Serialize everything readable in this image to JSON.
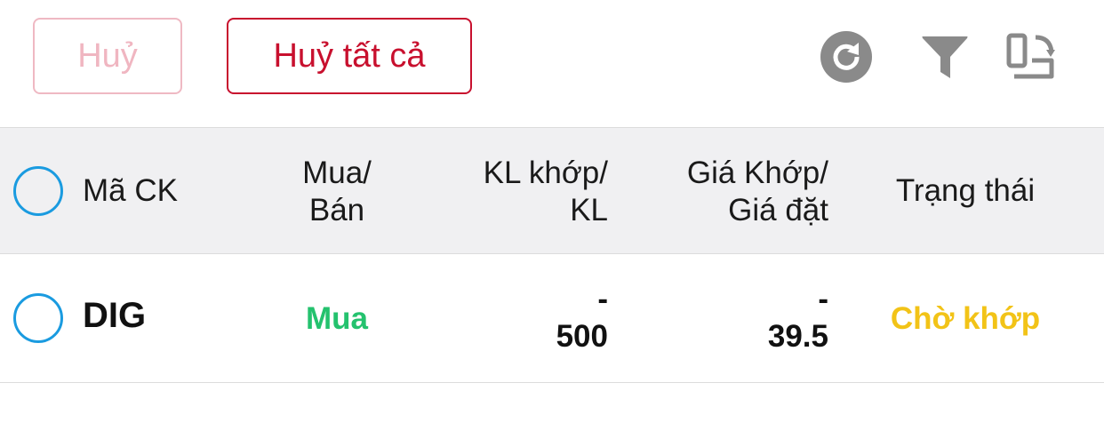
{
  "toolbar": {
    "cancel_label": "Huỷ",
    "cancel_all_label": "Huỷ tất cả",
    "icons": [
      "refresh-icon",
      "filter-icon",
      "layout-switch-icon"
    ]
  },
  "table": {
    "headers": {
      "code": "Mã CK",
      "side_line1": "Mua/",
      "side_line2": "Bán",
      "qty_line1": "KL khớp/",
      "qty_line2": "KL",
      "price_line1": "Giá Khớp/",
      "price_line2": "Giá đặt",
      "status": "Trạng thái"
    },
    "rows": [
      {
        "code": "DIG",
        "side": "Mua",
        "matched_qty": "-",
        "order_qty": "500",
        "matched_price": "-",
        "order_price": "39.5",
        "status": "Chờ khớp"
      }
    ]
  },
  "colors": {
    "primary_red": "#c8102e",
    "disabled_pink": "#f0b6c1",
    "buy_green": "#24c26e",
    "pending_yellow": "#f2c317",
    "radio_blue": "#1a9be0",
    "icon_gray": "#8a8a8a",
    "header_bg": "#f0f0f2"
  }
}
